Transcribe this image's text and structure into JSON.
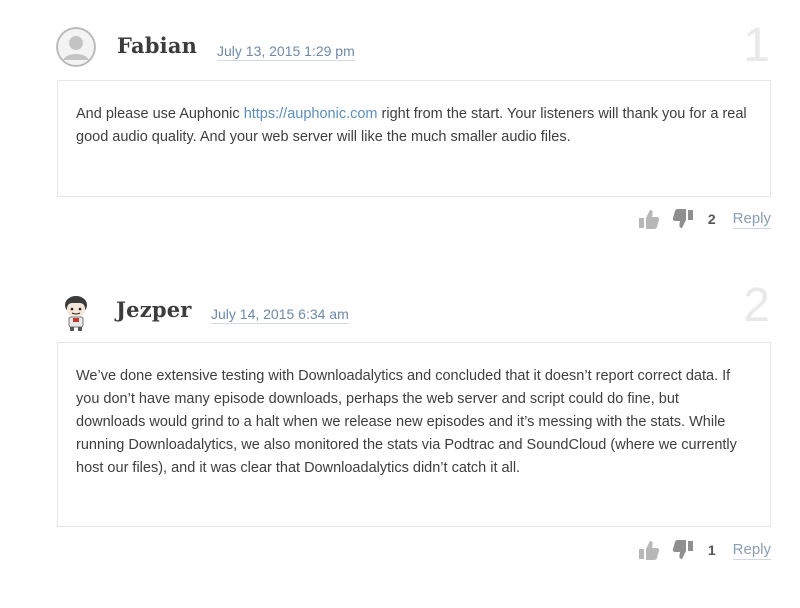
{
  "comments": [
    {
      "author": "Fabian",
      "date": "July 13, 2015 1:29 pm",
      "index": "1",
      "text_before_link": "And please use Auphonic ",
      "link_text": "https://auphonic.com",
      "text_after_link": " right from the start. Your listeners will thank you for a real good audio quality. And your web server will like the much smaller audio files.",
      "votes": "2",
      "reply_label": "Reply",
      "avatar_icon": "default-avatar-icon"
    },
    {
      "author": "Jezper",
      "date": "July 14, 2015 6:34 am",
      "index": "2",
      "text": "We’ve done extensive testing with Downloadalytics and concluded that it doesn’t report correct data. If you don’t have many episode downloads, perhaps the web server and script could do fine, but downloads would grind to a halt when we release new episodes and it’s messing with the stats. While running Downloadalytics, we also monitored the stats via Podtrac and SoundCloud (where we currently host our files), and it was clear that Downloadalytics didn’t catch it all.",
      "votes": "1",
      "reply_label": "Reply",
      "avatar_icon": "cartoon-avatar-icon"
    }
  ],
  "colors": {
    "link": "#5b8fb9",
    "date": "#6d8aa8",
    "index": "#e9e9e9",
    "border": "#e6e6e6"
  }
}
